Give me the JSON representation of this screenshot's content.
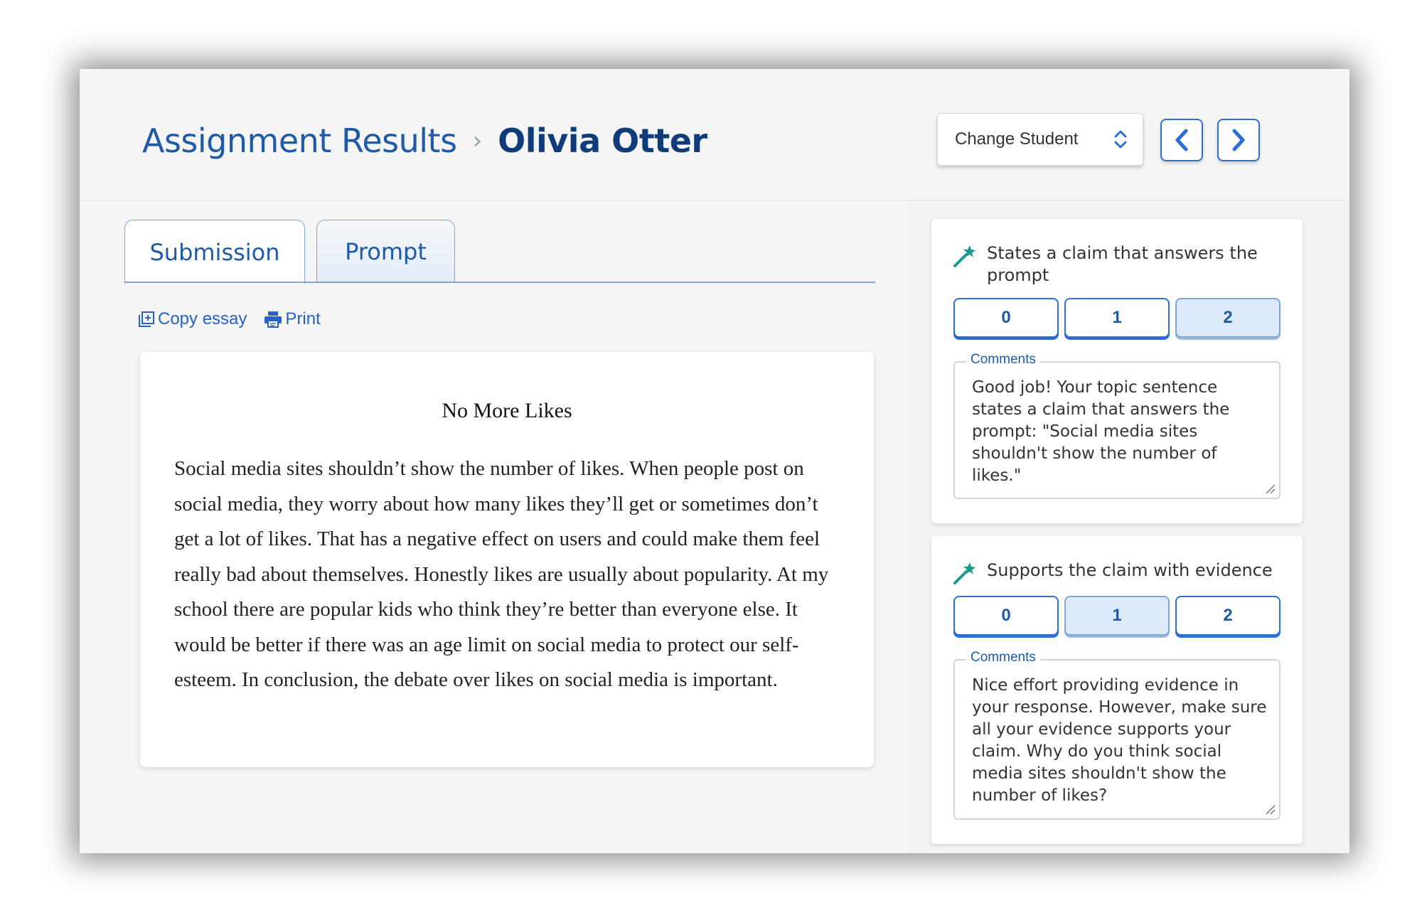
{
  "header": {
    "breadcrumb_root": "Assignment Results",
    "breadcrumb_separator": "›",
    "student_name": "Olivia Otter",
    "change_student_label": "Change Student"
  },
  "tabs": [
    {
      "label": "Submission",
      "active": true
    },
    {
      "label": "Prompt",
      "active": false
    }
  ],
  "tools": {
    "copy_label": "Copy essay",
    "print_label": "Print"
  },
  "essay": {
    "title": "No More Likes",
    "body": "Social media sites shouldn’t show the number of likes. When people post on social media, they worry about how many likes they’ll get or sometimes don’t get a lot of likes. That has a negative effect on users and could make them feel really bad about themselves. Honestly likes are usually about popularity. At my school there are popular kids who think they’re better than everyone else. It would be better if there was an age limit on social media to protect our self-esteem. In conclusion, the debate over likes on social media is important."
  },
  "rubric": [
    {
      "criterion": "States a claim that answers the prompt",
      "scores": [
        "0",
        "1",
        "2"
      ],
      "selected": "2",
      "comments_label": "Comments",
      "comment": "Good job! Your topic sentence states a claim that answers the prompt: \"Social media sites shouldn't show the number of likes.\""
    },
    {
      "criterion": "Supports the claim with evidence",
      "scores": [
        "0",
        "1",
        "2"
      ],
      "selected": "1",
      "comments_label": "Comments",
      "comment": "Nice effort providing evidence in your response. However, make sure all your evidence supports your claim. Why do you think social media sites shouldn't show the number of likes?"
    }
  ],
  "colors": {
    "accent": "#2c6ed5",
    "title_blue": "#1f5aa6",
    "name_navy": "#0f3c78",
    "selected_score_bg": "#dceaf9",
    "wand_teal": "#1a9a8f"
  }
}
